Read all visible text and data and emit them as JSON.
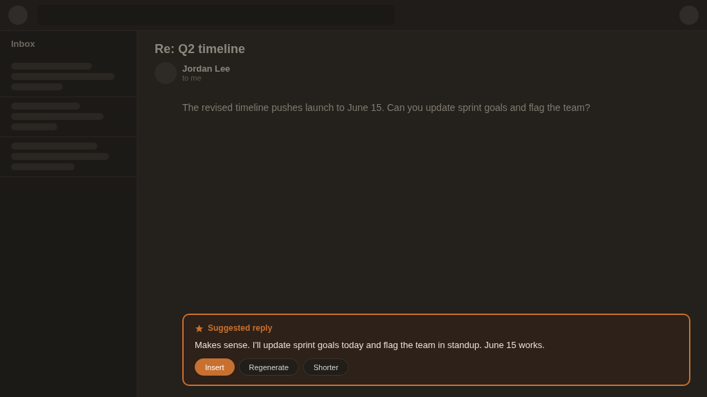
{
  "sidebar": {
    "title": "Inbox"
  },
  "message": {
    "subject": "Re: Q2 timeline",
    "sender": "Jordan Lee",
    "recipient": "to me",
    "body": "The revised timeline pushes launch to June 15. Can you update sprint goals and flag the team?"
  },
  "suggestion": {
    "title": "Suggested reply",
    "text": "Makes sense. I'll update sprint goals today and flag the team in standup. June 15 works.",
    "buttons": [
      {
        "label": "Insert",
        "kind": "primary"
      },
      {
        "label": "Regenerate",
        "kind": "secondary"
      },
      {
        "label": "Shorter",
        "kind": "secondary"
      }
    ]
  }
}
